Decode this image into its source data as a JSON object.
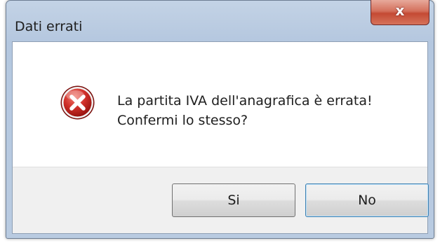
{
  "window": {
    "title": "Dati errati",
    "close_glyph": "x"
  },
  "message": {
    "line1": "La partita IVA dell'anagrafica è errata!",
    "line2": "Confermi lo stesso?",
    "icon": "error-icon"
  },
  "buttons": {
    "yes_label": "Si",
    "no_label": "No"
  },
  "colors": {
    "icon_red": "#c8231e",
    "close_button": "#c44a34",
    "frame": "#b9cbe1"
  }
}
